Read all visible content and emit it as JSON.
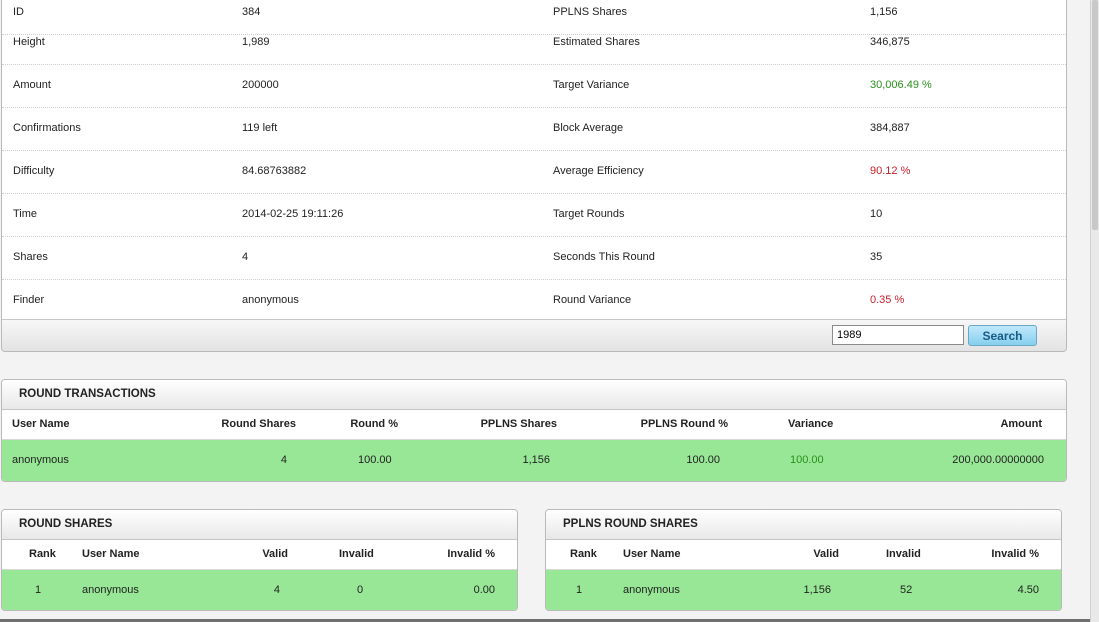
{
  "block_info": {
    "rows": [
      {
        "label": "ID",
        "value": "384",
        "label2": "PPLNS Shares",
        "value2": "1,156"
      },
      {
        "label": "Height",
        "value": "1,989",
        "label2": "Estimated Shares",
        "value2": "346,875"
      },
      {
        "label": "Amount",
        "value": "200000",
        "label2": "Target Variance",
        "value2": "30,006.49 %"
      },
      {
        "label": "Confirmations",
        "value": "119 left",
        "label2": "Block Average",
        "value2": "384,887"
      },
      {
        "label": "Difficulty",
        "value": "84.68763882",
        "label2": "Average Efficiency",
        "value2": "90.12 %"
      },
      {
        "label": "Time",
        "value": "2014-02-25 19:11:26",
        "label2": "Target Rounds",
        "value2": "10"
      },
      {
        "label": "Shares",
        "value": "4",
        "label2": "Seconds This Round",
        "value2": "35"
      },
      {
        "label": "Finder",
        "value": "anonymous",
        "label2": "Round Variance",
        "value2": "0.35 %"
      }
    ],
    "search": {
      "value": "1989",
      "button_label": "Search"
    }
  },
  "round_transactions": {
    "title": "ROUND TRANSACTIONS",
    "headers": {
      "user_name": "User Name",
      "round_shares": "Round Shares",
      "round_pct": "Round %",
      "pplns_shares": "PPLNS Shares",
      "pplns_round_pct": "PPLNS Round %",
      "variance": "Variance",
      "amount": "Amount"
    },
    "rows": [
      {
        "user_name": "anonymous",
        "round_shares": "4",
        "round_pct": "100.00",
        "pplns_shares": "1,156",
        "pplns_round_pct": "100.00",
        "variance": "100.00",
        "amount": "200,000.00000000"
      }
    ]
  },
  "round_shares": {
    "title": "ROUND SHARES",
    "headers": {
      "rank": "Rank",
      "user_name": "User Name",
      "valid": "Valid",
      "invalid": "Invalid",
      "invalid_pct": "Invalid %"
    },
    "rows": [
      {
        "rank": "1",
        "user_name": "anonymous",
        "valid": "4",
        "invalid": "0",
        "invalid_pct": "0.00"
      }
    ]
  },
  "pplns_round_shares": {
    "title": "PPLNS ROUND SHARES",
    "headers": {
      "rank": "Rank",
      "user_name": "User Name",
      "valid": "Valid",
      "invalid": "Invalid",
      "invalid_pct": "Invalid %"
    },
    "rows": [
      {
        "rank": "1",
        "user_name": "anonymous",
        "valid": "1,156",
        "invalid": "52",
        "invalid_pct": "4.50"
      }
    ]
  },
  "colors": {
    "positive": "#2a8f1c",
    "negative": "#c8202a",
    "row_highlight": "#98e796",
    "search_button": "#86cfee"
  }
}
